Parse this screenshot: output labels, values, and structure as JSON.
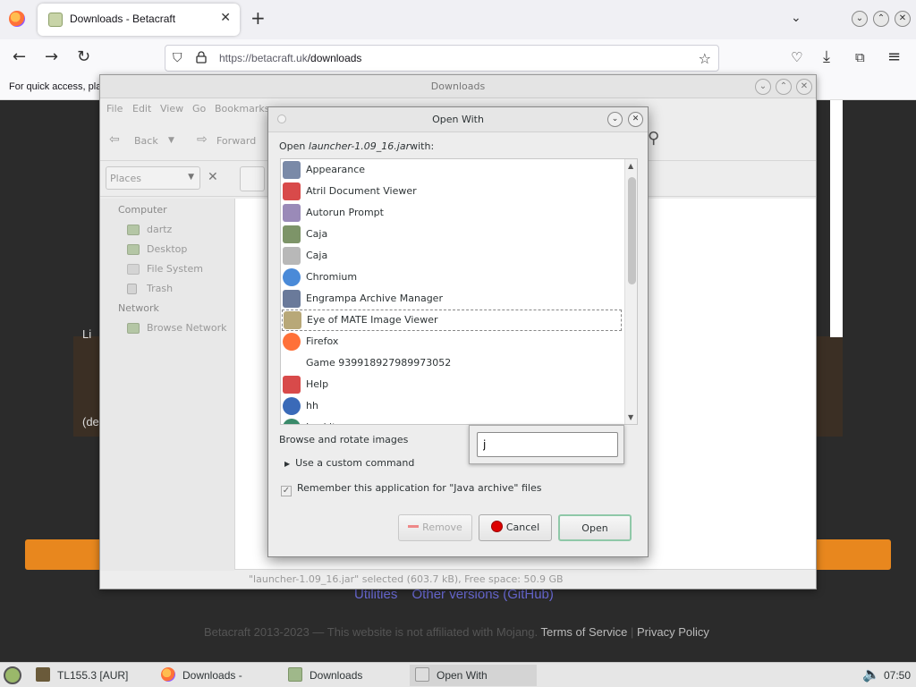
{
  "browser": {
    "tab_title": "Downloads - Betacraft",
    "new_tab": "+",
    "url_host": "https://betacraft.uk",
    "url_path": "/downloads",
    "bookmarks_text": "For quick access, plac"
  },
  "webpage": {
    "links": [
      "Utilities",
      "Other versions (GitHub)"
    ],
    "footer_text": "Betacraft 2013-2023 — This website is not affiliated with Mojang.",
    "footer_links": [
      "Terms of Service",
      "Privacy Policy"
    ],
    "footer_sep": "|",
    "frag_li": "Li",
    "frag_de": "(de"
  },
  "file_manager": {
    "title": "Downloads",
    "menu": [
      "File",
      "Edit",
      "View",
      "Go",
      "Bookmarks"
    ],
    "back_label": "Back",
    "forward_label": "Forward",
    "places_label": "Places",
    "sidebar": {
      "computer_heading": "Computer",
      "computer_items": [
        "dartz",
        "Desktop",
        "File System",
        "Trash"
      ],
      "network_heading": "Network",
      "network_items": [
        "Browse Network"
      ]
    },
    "status": "\"launcher-1.09_16.jar\" selected (603.7 kB), Free space: 50.9 GB"
  },
  "dialog": {
    "title": "Open With",
    "prompt_prefix": "Open",
    "prompt_file": "launcher-1.09_16.jar",
    "prompt_suffix": "with:",
    "apps": [
      {
        "name": "Appearance",
        "color": "#7a8aa8"
      },
      {
        "name": "Atril Document Viewer",
        "color": "#d84a4a"
      },
      {
        "name": "Autorun Prompt",
        "color": "#9a8ab8"
      },
      {
        "name": "Caja",
        "color": "#7d9468"
      },
      {
        "name": "Caja",
        "color": "#b8b8b8"
      },
      {
        "name": "Chromium",
        "color": "#4a8ad8"
      },
      {
        "name": "Engrampa Archive Manager",
        "color": "#6a7a9a"
      },
      {
        "name": "Eye of MATE Image Viewer",
        "color": "#b8a878"
      },
      {
        "name": "Firefox",
        "color": "#ff7139"
      },
      {
        "name": "Game 939918927989973052",
        "color": ""
      },
      {
        "name": "Help",
        "color": "#d84a4a"
      },
      {
        "name": "hh",
        "color": "#3a6ab8"
      },
      {
        "name": "Luakit",
        "color": "#3a8a6a"
      }
    ],
    "selected_index": 7,
    "description": "Browse and rotate images",
    "search_value": "j",
    "custom_command": "Use a custom command",
    "remember": "Remember this application for \"Java archive\" files",
    "buttons": {
      "remove": "Remove",
      "cancel": "Cancel",
      "open": "Open"
    }
  },
  "taskbar": {
    "items": [
      "TL155.3 [AUR]",
      "Downloads - Betacra...",
      "Downloads",
      "Open With"
    ],
    "clock": "07:50"
  }
}
